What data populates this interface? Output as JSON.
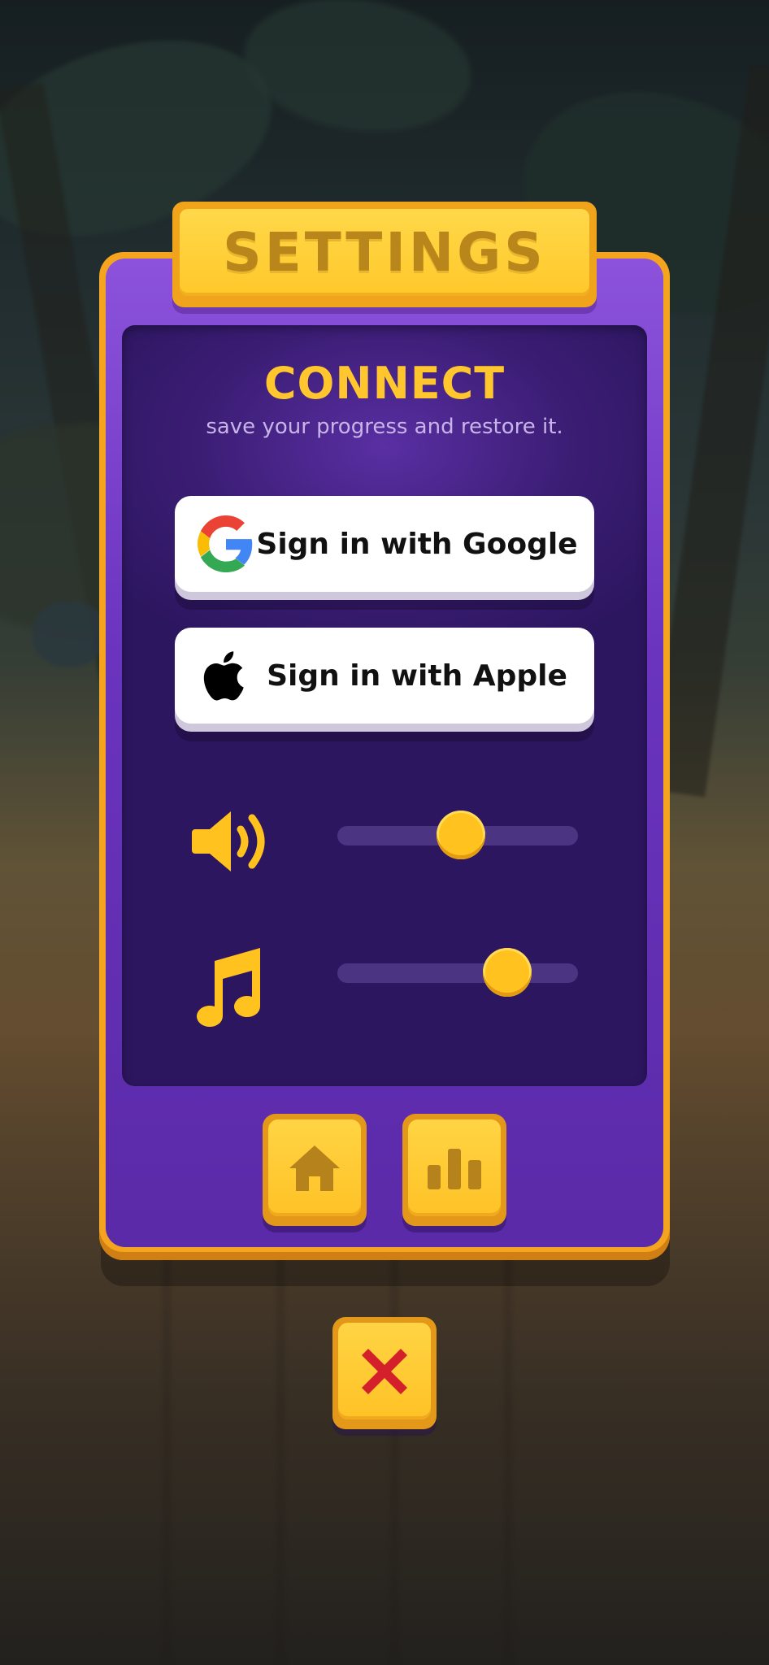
{
  "dialog": {
    "title": "SETTINGS"
  },
  "connect": {
    "title": "CONNECT",
    "subtitle": "save your progress and restore it.",
    "google_label": "Sign in with Google",
    "apple_label": "Sign in with Apple"
  },
  "audio": {
    "sound_volume_fraction": 0.5,
    "music_volume_fraction": 0.75
  },
  "icons": {
    "google": "google-logo-icon",
    "apple": "apple-logo-icon",
    "sound": "speaker-icon",
    "music": "music-note-icon",
    "home": "home-icon",
    "stats": "bar-chart-icon",
    "close": "close-icon"
  },
  "colors": {
    "accent_yellow": "#ffc62e",
    "panel_purple": "#6a34be",
    "content_purple": "#3b1d74",
    "close_red": "#d3202a"
  }
}
